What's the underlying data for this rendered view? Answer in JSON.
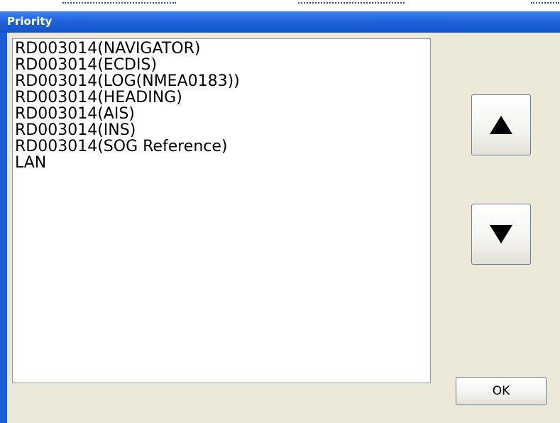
{
  "window": {
    "title": "Priority"
  },
  "list": {
    "items": [
      "RD003014(NAVIGATOR)",
      "RD003014(ECDIS)",
      "RD003014(LOG(NMEA0183))",
      "RD003014(HEADING)",
      "RD003014(AIS)",
      "RD003014(INS)",
      "RD003014(SOG Reference)",
      "LAN"
    ]
  },
  "buttons": {
    "up_icon": "up-triangle-icon",
    "down_icon": "down-triangle-icon",
    "ok_label": "OK"
  },
  "colors": {
    "titlebar": "#1f63dc",
    "window_bg": "#ece9d8",
    "list_bg": "#ffffff"
  }
}
